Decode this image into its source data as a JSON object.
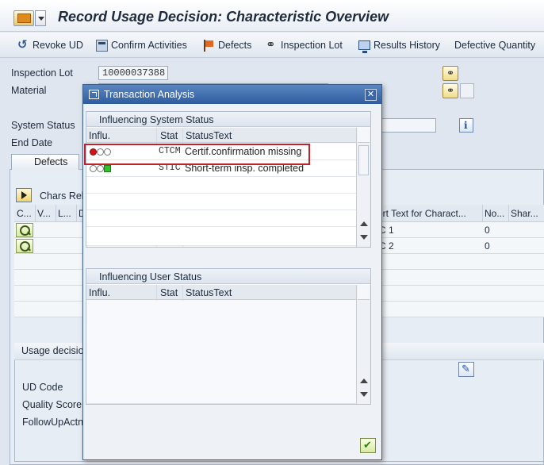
{
  "window": {
    "title": "Record Usage Decision: Characteristic Overview"
  },
  "toolbar": {
    "revoke_ud": "Revoke UD",
    "confirm_activities": "Confirm Activities",
    "defects": "Defects",
    "inspection_lot": "Inspection Lot",
    "results_history": "Results History",
    "defective_quantity": "Defective Quantity"
  },
  "header": {
    "inspection_lot_label": "Inspection Lot",
    "inspection_lot_value": "10000037388",
    "material_label": "Material",
    "system_status_label": "System Status",
    "end_date_label": "End Date"
  },
  "tabs": {
    "defects": "Defects"
  },
  "characteristics": {
    "chars_button_label": "Chars Rele",
    "columns": [
      "C...",
      "V...",
      "L...",
      "D",
      "ort Text for Charact...",
      "No...",
      "Shar..."
    ],
    "rows": [
      {
        "short_text": "C 1",
        "no": "0"
      },
      {
        "short_text": "C 2",
        "no": "0"
      }
    ]
  },
  "usage_decision": {
    "header": "Usage decisio",
    "ud_code_label": "UD Code",
    "quality_score_label": "Quality Score",
    "follow_up_label": "FollowUpActn"
  },
  "dialog": {
    "title": "Transaction Analysis",
    "system_section": {
      "title": "Influencing System Status",
      "columns": [
        "Influ.",
        "Stat",
        "StatusText"
      ],
      "rows": [
        {
          "status": "CTCM",
          "text": "Certif.confirmation missing",
          "lights": "red"
        },
        {
          "status": "STIC",
          "text": "Short-term insp. completed",
          "lights": "green"
        }
      ]
    },
    "user_section": {
      "title": "Influencing User Status",
      "columns": [
        "Influ.",
        "Stat",
        "StatusText"
      ]
    }
  },
  "colors": {
    "highlight": "#c0222a",
    "dialog_title": "#2e5c9e",
    "status_red": "#d0161c",
    "status_green": "#30c22d"
  }
}
